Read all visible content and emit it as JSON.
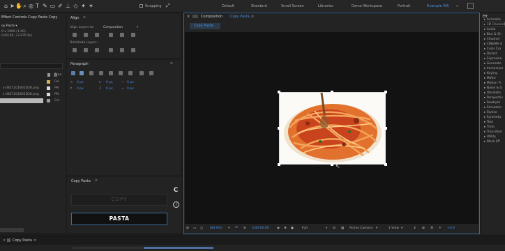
{
  "toolbar": {
    "tools": [
      "home-icon",
      "arrow-icon",
      "hand-icon",
      "zoom-icon",
      "camera-icon",
      "move-icon",
      "rect-icon",
      "pen-icon",
      "type-icon",
      "brush-icon",
      "stamp-icon",
      "eraser-icon",
      "roto-icon",
      "puppet-icon"
    ],
    "snapping_label": "Snapping",
    "workspaces": [
      "Default",
      "Standard",
      "Small Screen",
      "Libraries",
      "Demo Workspace",
      "Portrait",
      "Example WS"
    ],
    "active_workspace": "Example WS"
  },
  "project_panel": {
    "title": "Effect Controls Copy Paste Copy",
    "item_name": "oy Pasta ▾",
    "meta_line1": "0 x 1080 (1.00)",
    "meta_line2": "0;00;00, 23.976 fps",
    "column_type": "Type",
    "rows": [
      {
        "name": "",
        "type": "Fol"
      },
      {
        "name": "s-0827201805D28.png",
        "type": "PN"
      },
      {
        "name": "s-0827201805D28.png",
        "type": "PN"
      },
      {
        "name": "",
        "type": "Cor"
      }
    ]
  },
  "align_panel": {
    "title": "Align",
    "align_layers_to_label": "Align Layers to:",
    "align_layers_to_value": "Composition",
    "distribute_label": "Distribute Layers:"
  },
  "paragraph_panel": {
    "title": "Paragraph",
    "values": [
      "0 px",
      "0 px",
      "0 px",
      "0 px",
      "0 px",
      "0 px"
    ]
  },
  "copy_pasta_panel": {
    "title": "Copy Pasta",
    "copy_label": "COPY",
    "pasta_label": "PASTA"
  },
  "composition": {
    "tab_label": "Composition",
    "tab_name": "Copy Pasta",
    "sub_tab": "Copy Pasta",
    "zoom": "(84.6%)",
    "timecode": "0;00;00;00",
    "resolution": "Full",
    "camera": "Active Camera",
    "view": "1 View",
    "exposure": "+0.0"
  },
  "effects_panel": {
    "title": "Eff",
    "items": [
      "Animatio",
      "3D Channel",
      "Audio",
      "Blur & Sh",
      "Channel",
      "CINEMA 4",
      "Color Cor",
      "Distort",
      "Expressio",
      "Generate",
      "Immersive",
      "Keying",
      "Matte",
      "Motion Ti",
      "Noise & G",
      "Obsolete",
      "Perspectiv",
      "Rowbyte",
      "Simulatio",
      "Stylize",
      "Synthetic",
      "Text",
      "Time",
      "Transition",
      "Utility",
      "Work Eff"
    ]
  },
  "timeline": {
    "tab_label": "Copy Pasta"
  },
  "colors": {
    "accent": "#4a90e2",
    "panel_bg": "#232323",
    "viewer_bg": "#121212",
    "border_blue": "#3d6d99"
  }
}
